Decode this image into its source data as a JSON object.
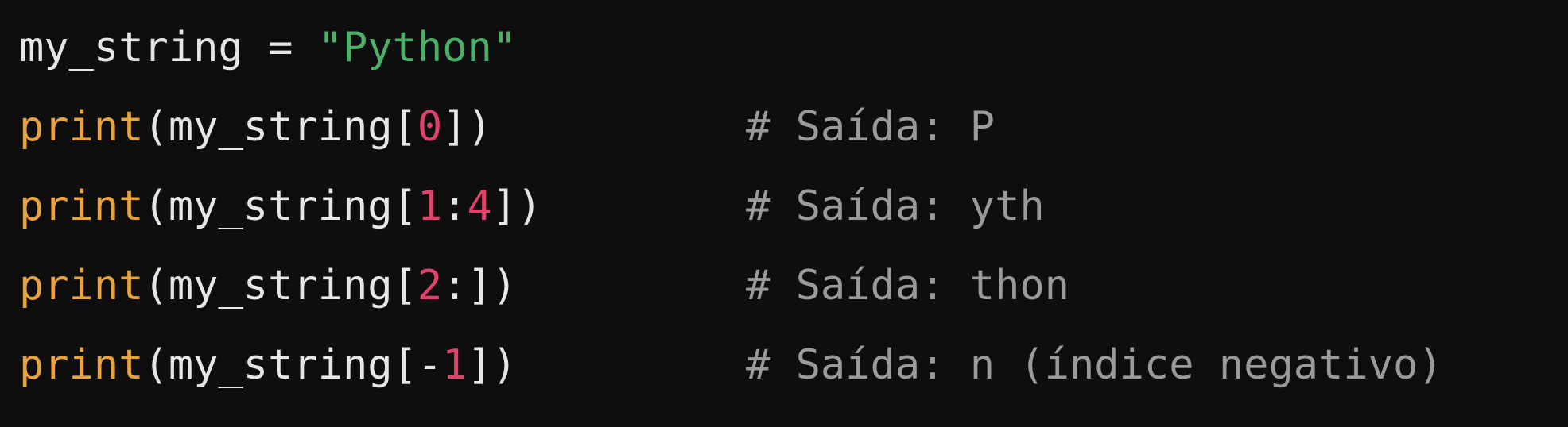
{
  "colors": {
    "background": "#0e0e0e",
    "text": "#e6e6e6",
    "keyword": "#e8a33d",
    "string": "#4caf6a",
    "number": "#e0426c",
    "comment": "#9a9a9a"
  },
  "code": {
    "line1": {
      "var": "my_string",
      "op": " = ",
      "str": "\"Python\""
    },
    "line2": {
      "fn": "print",
      "open": "(my_string[",
      "n1": "0",
      "close": "])",
      "comment": "# Saída: P"
    },
    "line3": {
      "fn": "print",
      "open": "(my_string[",
      "n1": "1",
      "sep": ":",
      "n2": "4",
      "close": "])",
      "comment": "# Saída: yth"
    },
    "line4": {
      "fn": "print",
      "open": "(my_string[",
      "n1": "2",
      "close": ":])",
      "comment": "# Saída: thon"
    },
    "line5": {
      "fn": "print",
      "open": "(my_string[",
      "minus": "-",
      "n1": "1",
      "close": "])",
      "comment": "# Saída: n (índice negativo)"
    }
  }
}
